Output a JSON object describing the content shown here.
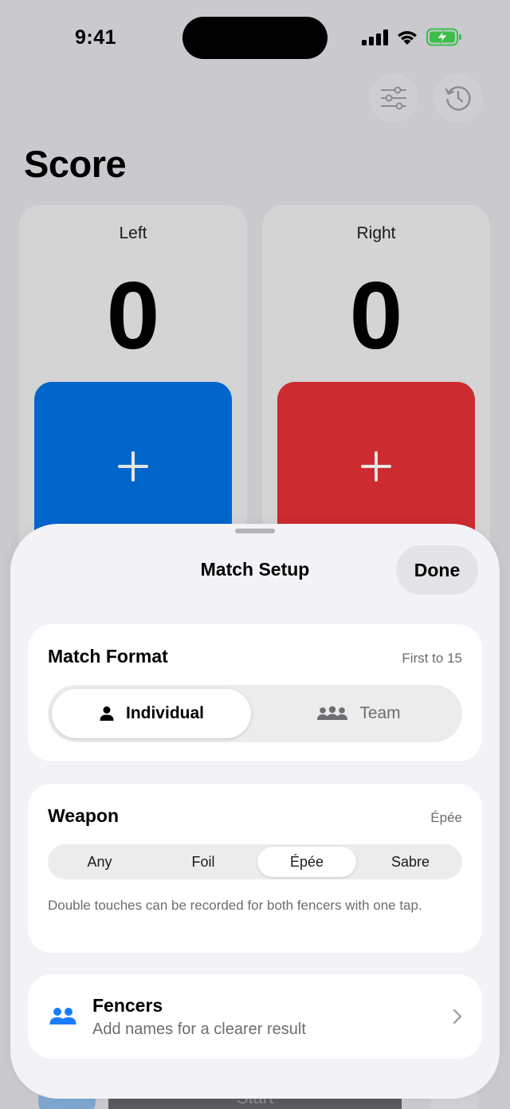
{
  "status_bar": {
    "time": "9:41"
  },
  "screen": {
    "title": "Score",
    "left": {
      "label": "Left",
      "score": "0",
      "color": "#0066cc"
    },
    "right": {
      "label": "Right",
      "score": "0",
      "color": "#cc2b30"
    },
    "start_label": "Start"
  },
  "sheet": {
    "title": "Match Setup",
    "done_label": "Done",
    "match_format": {
      "title": "Match Format",
      "value": "First to 15",
      "options": [
        {
          "label": "Individual",
          "icon": "person-icon",
          "selected": true
        },
        {
          "label": "Team",
          "icon": "people-three-icon",
          "selected": false
        }
      ]
    },
    "weapon": {
      "title": "Weapon",
      "value": "Épée",
      "options": [
        "Any",
        "Foil",
        "Épée",
        "Sabre"
      ],
      "selected_index": 2,
      "note": "Double touches can be recorded for both fencers with one tap."
    },
    "fencers": {
      "title": "Fencers",
      "subtitle": "Add names for a clearer result",
      "icon": "people-icon",
      "accent": "#1a7cff"
    }
  }
}
